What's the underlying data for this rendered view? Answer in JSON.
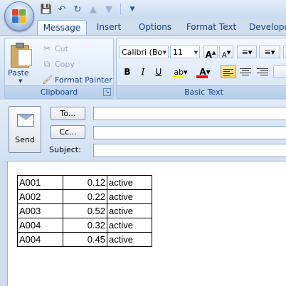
{
  "quick_access": {
    "icons": [
      "save-icon",
      "undo-icon",
      "redo-icon",
      "up-arrow-icon",
      "down-arrow-icon",
      "customize-icon"
    ]
  },
  "tabs": [
    {
      "label": "Message",
      "active": true
    },
    {
      "label": "Insert",
      "active": false
    },
    {
      "label": "Options",
      "active": false
    },
    {
      "label": "Format Text",
      "active": false
    },
    {
      "label": "Develope",
      "active": false
    }
  ],
  "clipboard": {
    "paste_label": "Paste",
    "cut_label": "Cut",
    "copy_label": "Copy",
    "format_painter_label": "Format Painter",
    "group_label": "Clipboard"
  },
  "basic_text": {
    "font_name": "Calibri (Bo",
    "font_size": "11",
    "group_label": "Basic Text",
    "bold": "B",
    "italic": "I",
    "underline": "U",
    "highlight_color": "#ffff00",
    "font_color": "#ff0000"
  },
  "header": {
    "send_label": "Send",
    "to_label": "To...",
    "cc_label": "Cc...",
    "subject_label": "Subject:",
    "to_value": "",
    "cc_value": "",
    "subject_value": ""
  },
  "body_table": {
    "rows": [
      [
        "A001",
        "0.12",
        "active"
      ],
      [
        "A002",
        "0.22",
        "active"
      ],
      [
        "A003",
        "0.52",
        "active"
      ],
      [
        "A004",
        "0.32",
        "active"
      ],
      [
        "A004",
        "0.45",
        "active"
      ]
    ]
  },
  "colors": {
    "ribbon_text": "#15428b",
    "ribbon_bg": "#d5e3f4",
    "active_button": "#ffd35c"
  }
}
